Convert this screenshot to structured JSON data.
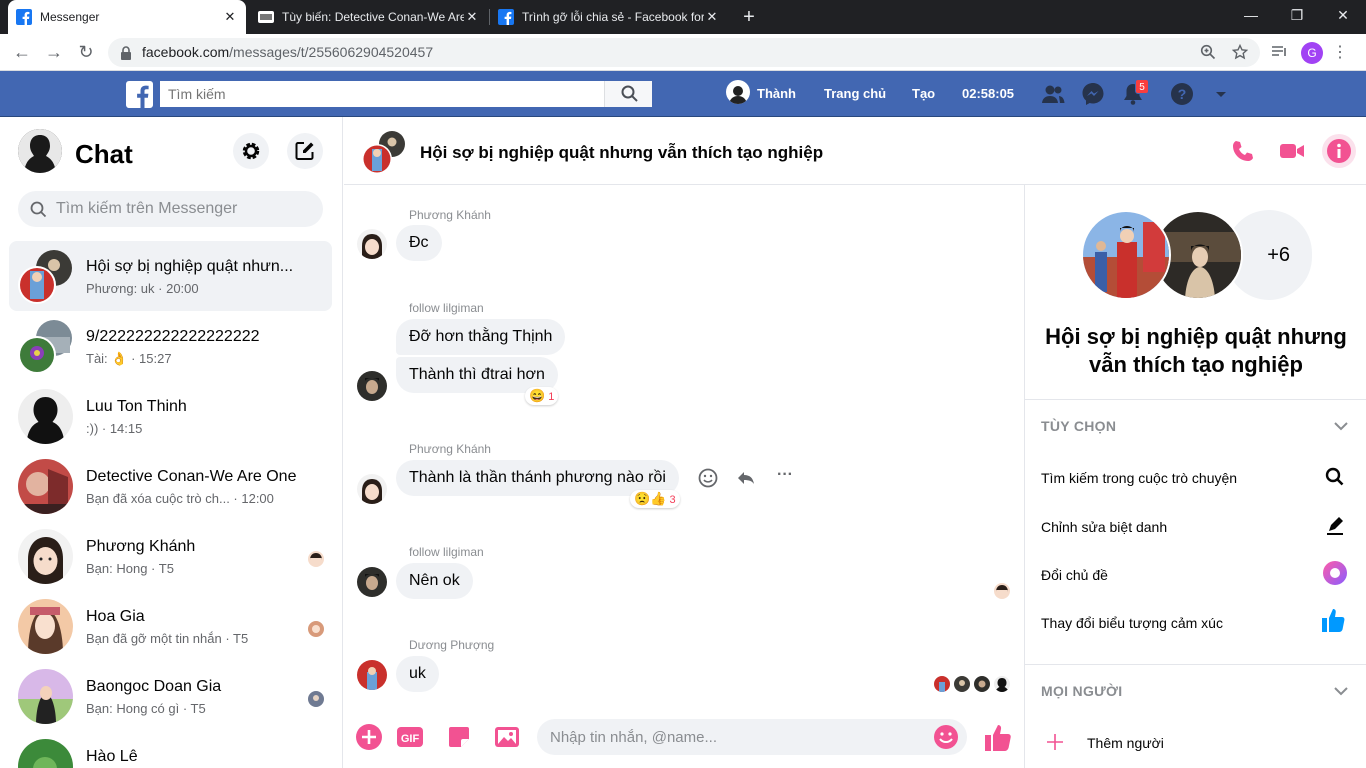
{
  "browser": {
    "tabs": [
      {
        "title": "Messenger",
        "icon": "facebook-favicon"
      },
      {
        "title": "Tùy biến: Detective Conan-We Are One",
        "icon": "site-favicon"
      },
      {
        "title": "Trình gỡ lỗi chia sẻ - Facebook for Developers",
        "icon": "facebook-favicon"
      }
    ],
    "url_host": "facebook.com",
    "url_path": "/messages/t/2556062904520457",
    "profile_letter": "G"
  },
  "fb": {
    "search_placeholder": "Tìm kiếm",
    "user": "Thành",
    "home": "Trang chủ",
    "create": "Tạo",
    "clock": "02:58:05",
    "notif_count": "5",
    "brand_color": "#4267b2"
  },
  "sidebar": {
    "title": "Chat",
    "search_placeholder": "Tìm kiếm trên Messenger",
    "conversations": [
      {
        "name": "Hội sợ bị nghiệp quật nhưn...",
        "preview": "Phương: uk · 20:00",
        "selected": true
      },
      {
        "name": "9/222222222222222222",
        "preview": "Tài: 👌 · 15:27"
      },
      {
        "name": "Luu Ton Thinh",
        "preview": ":)) · 14:15"
      },
      {
        "name": "Detective Conan-We Are One",
        "preview": "Bạn đã xóa cuộc trò ch...   · 12:00"
      },
      {
        "name": "Phương Khánh",
        "preview": "Bạn: Hong · T5"
      },
      {
        "name": "Hoa Gia",
        "preview": "Bạn đã gỡ một tin nhắn · T5"
      },
      {
        "name": "Baongoc Doan Gia",
        "preview": "Bạn: Hong có gì · T5"
      },
      {
        "name": "Hào Lê",
        "preview": ""
      }
    ]
  },
  "thread": {
    "title": "Hội sợ bị nghiệp quật nhưng vẫn thích tạo nghiệp",
    "accent": "#f25292",
    "messages": [
      {
        "sender": "Phương Khánh",
        "texts": [
          "Đc"
        ]
      },
      {
        "sender": "follow lilgiman",
        "texts": [
          "Đỡ hơn thằng Thịnh",
          "Thành thì đtrai hơn"
        ],
        "reaction": "😄",
        "reaction_count": "1"
      },
      {
        "sender": "Phương Khánh",
        "texts": [
          "Thành là thần thánh phương nào rồi"
        ],
        "reaction": "😟👍",
        "reaction_count": "3"
      },
      {
        "sender": "follow lilgiman",
        "texts": [
          "Nên ok"
        ]
      },
      {
        "sender": "Dương Phượng",
        "texts": [
          "uk"
        ]
      }
    ],
    "composer_placeholder": "Nhập tin nhắn, @name..."
  },
  "info": {
    "title": "Hội sợ bị nghiệp quật nhưng vẫn thích tạo nghiệp",
    "more_members": "+6",
    "options_header": "TÙY CHỌN",
    "options": [
      {
        "label": "Tìm kiếm trong cuộc trò chuyện",
        "icon": "search-icon"
      },
      {
        "label": "Chỉnh sửa biệt danh",
        "icon": "pencil-icon"
      },
      {
        "label": "Đổi chủ đề",
        "icon": "theme-color-icon"
      },
      {
        "label": "Thay đổi biểu tượng cảm xúc",
        "icon": "thumbs-up-icon"
      }
    ],
    "people_header": "MỌI NGƯỜI",
    "add_people": "Thêm người"
  }
}
